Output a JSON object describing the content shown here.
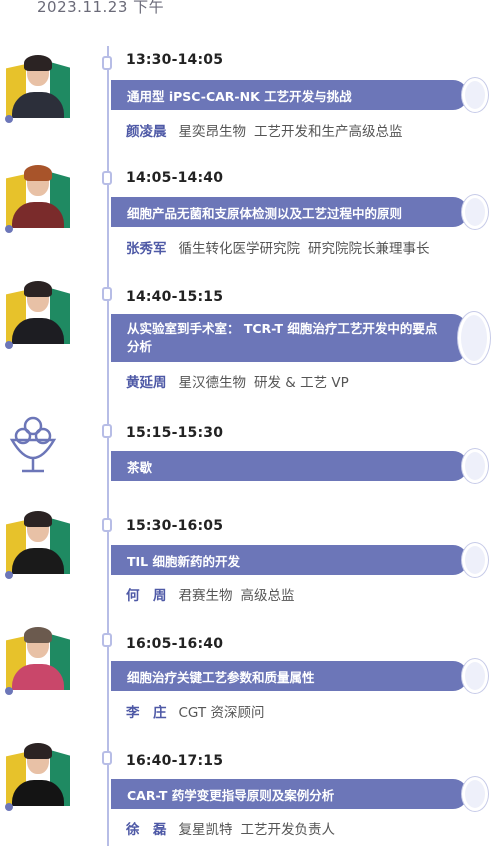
{
  "date": "2023.11.23 下午",
  "sessions": [
    {
      "time": "13:30-14:05",
      "title": "通用型 iPSC-CAR-NK 工艺开发与挑战",
      "name": "颜凌晨",
      "org": "星奕昂生物",
      "role": "工艺开发和生产高级总监"
    },
    {
      "time": "14:05-14:40",
      "title": "细胞产品无菌和支原体检测以及工艺过程中的原则",
      "name": "张秀军",
      "org": "循生转化医学研究院",
      "role": "研究院院长兼理事长"
    },
    {
      "time": "14:40-15:15",
      "title": "从实验室到手术室： TCR-T 细胞治疗工艺开发中的要点分析",
      "name": "黄延周",
      "org": "星汉德生物",
      "role": "研发 & 工艺 VP"
    },
    {
      "time": "15:15-15:30",
      "title": "茶歇"
    },
    {
      "time": "15:30-16:05",
      "title": "TIL 细胞新药的开发",
      "name": "何　周",
      "org": "君赛生物",
      "role": "高级总监"
    },
    {
      "time": "16:05-16:40",
      "title": "细胞治疗关键工艺参数和质量属性",
      "name": "李　庄",
      "org": "CGT 资深顾问",
      "role": ""
    },
    {
      "time": "16:40-17:15",
      "title": "CAR-T 药学变更指导原则及案例分析",
      "name": "徐　磊",
      "org": "复星凯特",
      "role": "工艺开发负责人"
    }
  ],
  "colors": {
    "accent": "#6c76b8",
    "name": "#4e59a6",
    "avatar_yellow": "#e7c22b",
    "avatar_green": "#1f8a62"
  }
}
